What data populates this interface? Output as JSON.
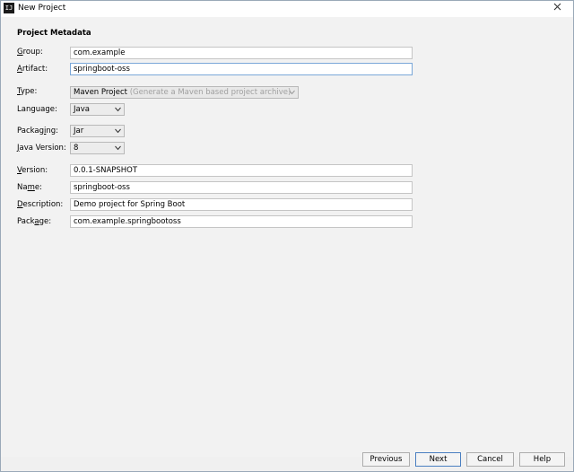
{
  "window": {
    "title": "New Project",
    "app_icon": "IJ"
  },
  "section": {
    "title": "Project Metadata"
  },
  "fields": {
    "group": {
      "label_ul": "G",
      "label_rest": "roup:",
      "value": "com.example"
    },
    "artifact": {
      "label_ul": "A",
      "label_rest": "rtifact:",
      "value": "springboot-oss"
    },
    "type": {
      "label_ul": "T",
      "label_rest": "ype:",
      "value": "Maven Project",
      "hint": "(Generate a Maven based project archive)"
    },
    "language": {
      "label": "Language:",
      "value": "Java"
    },
    "packaging": {
      "label_pre": "Packag",
      "label_ul": "i",
      "label_rest": "ng:",
      "value": "Jar"
    },
    "java_version": {
      "label_ul": "J",
      "label_rest": "ava Version:",
      "value": "8"
    },
    "version": {
      "label_ul": "V",
      "label_rest": "ersion:",
      "value": "0.0.1-SNAPSHOT"
    },
    "name": {
      "label_pre": "Na",
      "label_ul": "m",
      "label_rest": "e:",
      "value": "springboot-oss"
    },
    "description": {
      "label_ul": "D",
      "label_rest": "escription:",
      "value": "Demo project for Spring Boot"
    },
    "package": {
      "label_pre": "Pack",
      "label_ul": "a",
      "label_rest": "ge:",
      "value": "com.example.springbootoss"
    }
  },
  "buttons": {
    "previous": "Previous",
    "next": "Next",
    "cancel": "Cancel",
    "help": "Help"
  },
  "icons": {
    "close": "close-icon",
    "dropdown": "chevron-down-icon"
  }
}
